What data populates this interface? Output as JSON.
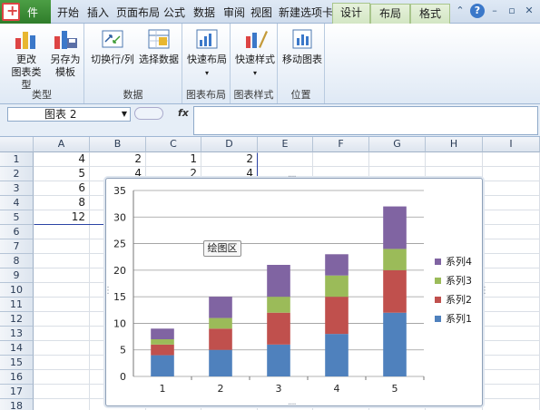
{
  "tabs": {
    "file": "件",
    "start": "开始",
    "insert": "插入",
    "page_layout": "页面布局",
    "formulas": "公式",
    "data": "数据",
    "review": "审阅",
    "view": "视图",
    "new_tab": "新建选项卡",
    "design": "设计",
    "layout": "布局",
    "format": "格式"
  },
  "ribbon": {
    "type_group": {
      "change_type": "更改\n图表类型",
      "save_template": "另存为\n模板",
      "label": "类型"
    },
    "data_group": {
      "switch_row_col": "切换行/列",
      "select_data": "选择数据",
      "label": "数据"
    },
    "layout_group": {
      "quick_layout": "快速布局",
      "label": "图表布局"
    },
    "style_group": {
      "quick_style": "快速样式",
      "label": "图表样式"
    },
    "location_group": {
      "move_chart": "移动图表",
      "label": "位置"
    }
  },
  "formula_bar": {
    "name_box": "图表 2",
    "fx": "fx",
    "content": ""
  },
  "columns": [
    "A",
    "B",
    "C",
    "D",
    "E",
    "F",
    "G",
    "H",
    "I"
  ],
  "rows": [
    "1",
    "2",
    "3",
    "4",
    "5",
    "6",
    "7",
    "8",
    "9",
    "10",
    "11",
    "12",
    "13",
    "14",
    "15",
    "16",
    "17",
    "18"
  ],
  "cells": [
    [
      "4",
      "2",
      "1",
      "2"
    ],
    [
      "5",
      "4",
      "2",
      "4"
    ],
    [
      "6",
      "",
      "",
      ""
    ],
    [
      "8",
      "",
      "",
      ""
    ],
    [
      "12",
      "",
      "",
      ""
    ]
  ],
  "chart_tooltip": "绘图区",
  "colors": {
    "s1": "#4f81bd",
    "s2": "#c0504d",
    "s3": "#9bbb59",
    "s4": "#8064a2"
  },
  "chart_data": {
    "type": "bar",
    "stacked": true,
    "categories": [
      "1",
      "2",
      "3",
      "4",
      "5"
    ],
    "series": [
      {
        "name": "系列1",
        "values": [
          4,
          5,
          6,
          8,
          12
        ]
      },
      {
        "name": "系列2",
        "values": [
          2,
          4,
          6,
          7,
          8
        ]
      },
      {
        "name": "系列3",
        "values": [
          1,
          2,
          3,
          4,
          4
        ]
      },
      {
        "name": "系列4",
        "values": [
          2,
          4,
          6,
          4,
          8
        ]
      }
    ],
    "yticks": [
      "0",
      "5",
      "10",
      "15",
      "20",
      "25",
      "30",
      "35"
    ],
    "ylim": [
      0,
      35
    ],
    "grid": true,
    "legend": "right"
  }
}
